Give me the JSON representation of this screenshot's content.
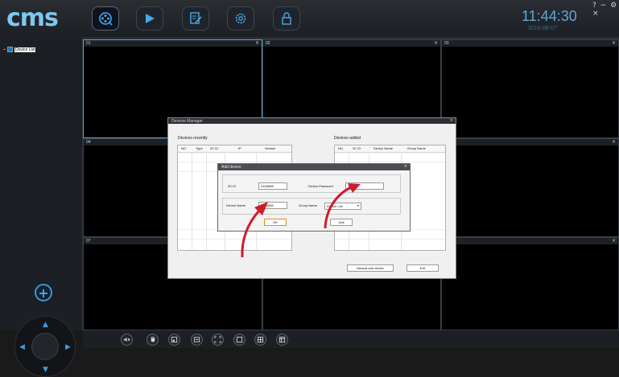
{
  "app": {
    "logo": "cms"
  },
  "nav": [
    {
      "name": "live-view-button",
      "icon": "camera-reel-icon",
      "active": true
    },
    {
      "name": "playback-button",
      "icon": "play-icon"
    },
    {
      "name": "log-button",
      "icon": "edit-log-icon"
    },
    {
      "name": "settings-button",
      "icon": "gear-icon"
    },
    {
      "name": "lock-button",
      "icon": "lock-icon"
    }
  ],
  "clock": {
    "time": "11:44:30",
    "date": "2016-08-07"
  },
  "window_controls": {
    "help": "?",
    "minimize": "−",
    "settings": "⚙",
    "close": "×"
  },
  "sidebar": {
    "tree_root_label": "Device List"
  },
  "views": [
    {
      "id": "01",
      "close": "×"
    },
    {
      "id": "02",
      "close": "×"
    },
    {
      "id": "03",
      "close": "×"
    },
    {
      "id": "04",
      "close": "×"
    },
    {
      "id": "07",
      "close": "×"
    }
  ],
  "device_manager": {
    "title": "Devices Manager",
    "close": "×",
    "recent_label": "Devices recently",
    "recent_columns": [
      "NO.",
      "Type",
      "3C ID",
      "IP",
      "Version"
    ],
    "added_label": "Devices added",
    "added_columns": [
      "NO.",
      "3C ID",
      "Device Name",
      "Group Name"
    ],
    "manual_add_label": "Manual add device",
    "exit_label": "Exit"
  },
  "add_device": {
    "title": "Add device",
    "close": "×",
    "id_label": "3C ID",
    "id_value": "4105898",
    "password_label": "Device Password",
    "password_value": "****",
    "name_label": "Device Name",
    "name_value": "4105898",
    "group_label": "Group Name",
    "group_value": "Device List",
    "ok_label": "OK",
    "quit_label": "Quit"
  },
  "annotation_color": "#d11a2a",
  "accent_color": "#3c97d8"
}
